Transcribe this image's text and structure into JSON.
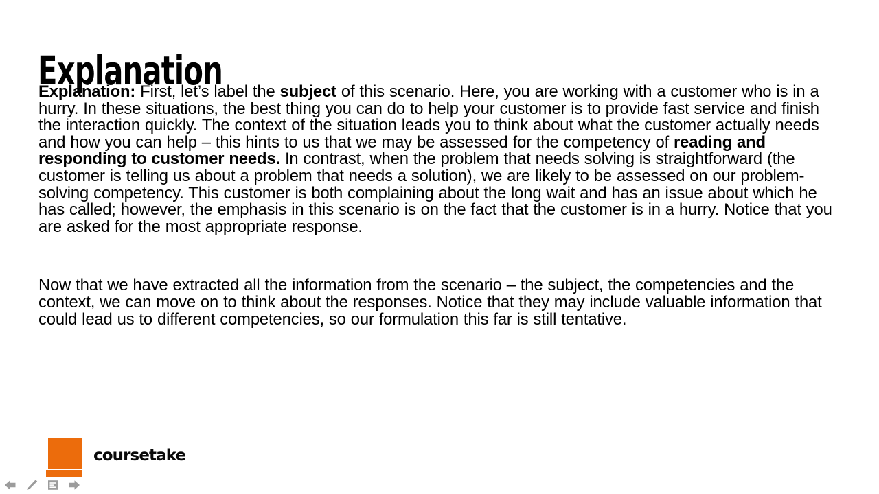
{
  "slide": {
    "title": "Explanation",
    "paragraphs": [
      {
        "id": "p1",
        "runs": [
          {
            "text": "Explanation:",
            "bold": true
          },
          {
            "text": " First, let’s label the ",
            "bold": false
          },
          {
            "text": "subject",
            "bold": true
          },
          {
            "text": " of this scenario. Here, you are working with a customer who is in a hurry. In these situations, the best thing you can do to help your customer is to provide fast service and finish the interaction quickly. The context of the situation leads you to think about what the customer actually needs and how you can help – this hints to us that we may be assessed for the competency of ",
            "bold": false
          },
          {
            "text": "reading and responding to customer needs.",
            "bold": true
          },
          {
            "text": " In contrast, when the problem that needs solving is straightforward (the customer is telling us about a problem that needs a solution), we are likely to be assessed on our problem-solving competency. This customer is both complaining about the long wait and has an issue about which he has called; however, the emphasis in this scenario is on the fact that the customer is in a hurry. Notice that you are asked for the most appropriate response.",
            "bold": false
          }
        ]
      },
      {
        "id": "p2",
        "runs": [
          {
            "text": "Now that we have extracted all the information from the scenario – the subject, the competencies and the context, we can move on to think about the responses. Notice that they may include valuable information that could lead us to different competencies, so our formulation this far is still tentative.",
            "bold": false
          }
        ]
      }
    ]
  },
  "logo": {
    "wordmark": "coursetake",
    "mark_color": "#EC6C0C"
  },
  "player": {
    "progress_color": "#EC6C0C",
    "icon_color": "#9C9C9C",
    "controls": [
      {
        "name": "previous-slide-button",
        "icon": "left-arrow-icon",
        "label": "Previous"
      },
      {
        "name": "annotate-button",
        "icon": "pencil-icon",
        "label": "Annotate"
      },
      {
        "name": "notes-button",
        "icon": "notes-icon",
        "label": "Notes"
      },
      {
        "name": "next-slide-button",
        "icon": "right-arrow-icon",
        "label": "Next"
      }
    ]
  }
}
